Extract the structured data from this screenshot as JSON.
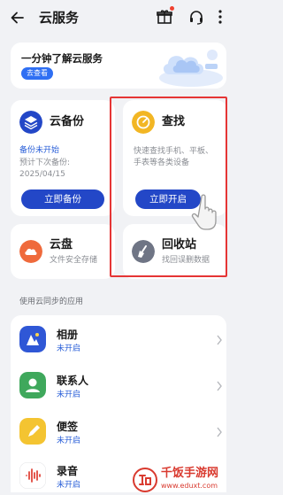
{
  "header": {
    "title": "云服务"
  },
  "banner": {
    "title": "一分钟了解云服务",
    "button": "去查看"
  },
  "cards": {
    "backup": {
      "title": "云备份",
      "status": "备份未开始",
      "desc1": "预计下次备份:",
      "desc2": "2025/04/15",
      "button": "立即备份"
    },
    "find": {
      "title": "查找",
      "desc1": "快速查找手机、平板、",
      "desc2": "手表等各类设备",
      "button": "立即开启"
    },
    "disk": {
      "title": "云盘",
      "desc": "文件安全存储"
    },
    "bin": {
      "title": "回收站",
      "desc": "找回误删数据"
    }
  },
  "sync": {
    "label": "使用云同步的应用",
    "items": [
      {
        "name": "相册",
        "status": "未开启"
      },
      {
        "name": "联系人",
        "status": "未开启"
      },
      {
        "name": "便签",
        "status": "未开启"
      },
      {
        "name": "录音",
        "status": "未开启"
      }
    ]
  },
  "watermark": {
    "name": "千饭手游网",
    "url": "www.eduxt.com"
  },
  "colors": {
    "accent": "#2347c7",
    "highlight": "#e53535",
    "background": "#f1f2f5"
  }
}
